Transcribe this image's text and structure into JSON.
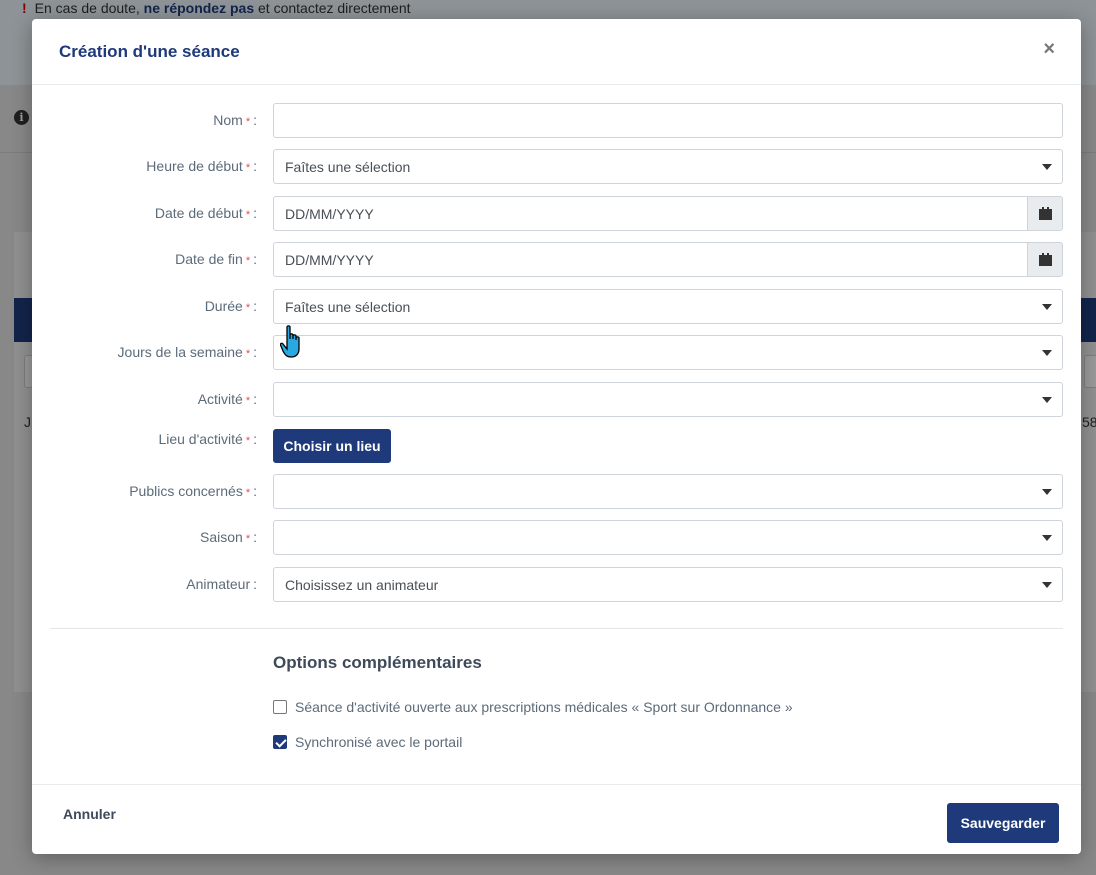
{
  "background": {
    "alert_prefix": "En cas de doute,",
    "alert_bold": "ne répondez pas",
    "alert_suffix": "et contactez directement",
    "alert_mark": "!",
    "right_number": "58",
    "left_letter": "J"
  },
  "modal": {
    "title": "Création d'une séance",
    "close_label": "×",
    "required_mark": "*",
    "fields": {
      "nom": {
        "label": "Nom",
        "value": ""
      },
      "heure_debut": {
        "label": "Heure de début",
        "value": "Faîtes une sélection"
      },
      "date_debut": {
        "label": "Date de début",
        "placeholder": "DD/MM/YYYY"
      },
      "date_fin": {
        "label": "Date de fin",
        "placeholder": "DD/MM/YYYY"
      },
      "duree": {
        "label": "Durée",
        "value": "Faîtes une sélection"
      },
      "jours": {
        "label": "Jours de la semaine",
        "value": ""
      },
      "activite": {
        "label": "Activité",
        "value": ""
      },
      "lieu": {
        "label": "Lieu d'activité",
        "button_label": "Choisir un lieu"
      },
      "publics": {
        "label": "Publics concernés",
        "value": ""
      },
      "saison": {
        "label": "Saison",
        "value": ""
      },
      "animateur": {
        "label": "Animateur",
        "value": "Choisissez un animateur"
      }
    },
    "options": {
      "title": "Options complémentaires",
      "sport_ordonnance": {
        "label": "Séance d'activité ouverte aux prescriptions médicales « Sport sur Ordonnance »",
        "checked": false
      },
      "synchronise": {
        "label": "Synchronisé avec le portail",
        "checked": true
      }
    },
    "footer": {
      "cancel_label": "Annuler",
      "save_label": "Sauvegarder"
    }
  },
  "colors": {
    "primary": "#1f3a7a",
    "required": "#d9534f"
  },
  "icons": [
    "calendar-icon",
    "caret-down-icon",
    "close-icon",
    "info-icon",
    "hand-pointer-cursor"
  ]
}
